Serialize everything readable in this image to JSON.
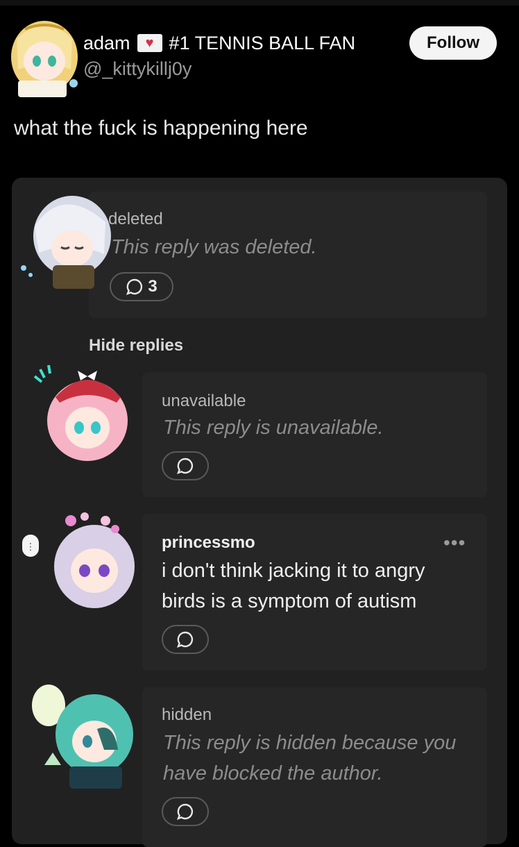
{
  "post": {
    "display_name": "adam",
    "name_suffix": "#1 TENNIS BALL FAN",
    "handle": "@_kittykillj0y",
    "follow_label": "Follow",
    "text": "what the fuck is happening here"
  },
  "replies": [
    {
      "author": "deleted",
      "body": "This reply was deleted.",
      "reply_count": "3"
    },
    {
      "author": "unavailable",
      "body": "This reply is unavailable."
    },
    {
      "author": "princessmo",
      "body_lines": [
        "i don't think jacking it to angry",
        "birds is a symptom of autism"
      ],
      "more": "•••"
    },
    {
      "author": "hidden",
      "body_lines": [
        "This reply is hidden because you",
        "have blocked the author."
      ]
    }
  ],
  "hide_replies_label": "Hide replies",
  "icons": [
    "heart-flag-icon",
    "comment-icon",
    "more-icon"
  ],
  "colors": {
    "background": "#000000",
    "panel": "#212121",
    "card": "#262626",
    "muted": "#8c8c8c"
  }
}
